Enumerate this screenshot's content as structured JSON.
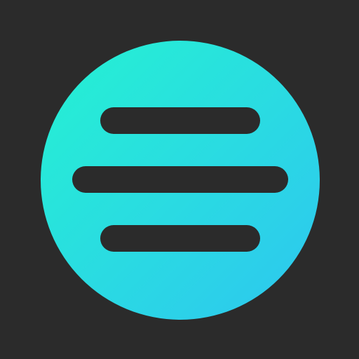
{
  "app_icon": {
    "icon": "hamburger-menu-icon",
    "colors": {
      "background": "#2b2b2b",
      "gradient_start": "#25f2d2",
      "gradient_end": "#2ec6f0",
      "bars": "#2b2b2b"
    },
    "bars": 3
  }
}
